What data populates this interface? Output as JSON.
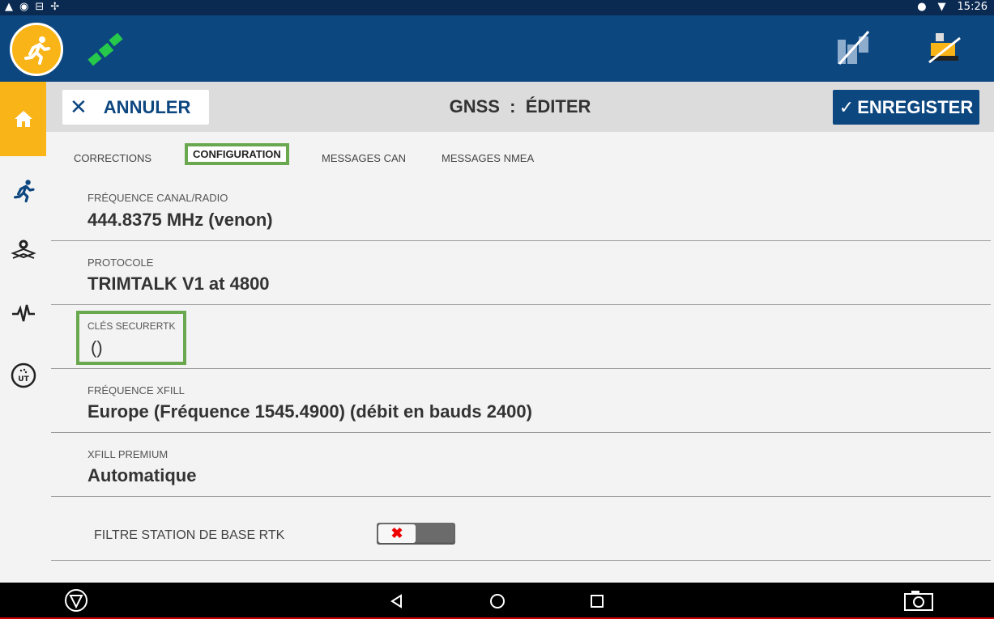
{
  "status_bar": {
    "time": "15:26"
  },
  "header": {
    "cancel_label": "ANNULER",
    "title": "GNSS  :  ÉDITER",
    "save_label": "ENREGISTER"
  },
  "tabs": [
    {
      "label": "CORRECTIONS"
    },
    {
      "label": "CONFIGURATION",
      "active": true
    },
    {
      "label": "MESSAGES CAN"
    },
    {
      "label": "MESSAGES NMEA"
    }
  ],
  "fields": [
    {
      "label": "FRÉQUENCE CANAL/RADIO",
      "value": "444.8375 MHz (venon)"
    },
    {
      "label": "PROTOCOLE",
      "value": "TRIMTALK V1 at 4800"
    },
    {
      "label": "CLÉS SECURERTK",
      "value": "()"
    },
    {
      "label": "FRÉQUENCE XFILL",
      "value": "Europe (Fréquence 1545.4900) (débit en bauds 2400)"
    },
    {
      "label": "XFILL PREMIUM",
      "value": "Automatique"
    }
  ],
  "toggle_row": {
    "label": "FILTRE STATION DE BASE RTK",
    "state": "off"
  },
  "colors": {
    "brand_blue": "#0d4780",
    "accent_yellow": "#f9b518",
    "highlight_green": "#6aa84f"
  },
  "icons": [
    "runner-icon",
    "satellite-icon",
    "field-flag-icon",
    "vehicle-icon",
    "home-icon",
    "settings-layer-icon",
    "pulse-icon",
    "ut-icon",
    "back-icon",
    "home-circle-icon",
    "recents-icon",
    "camera-icon"
  ]
}
